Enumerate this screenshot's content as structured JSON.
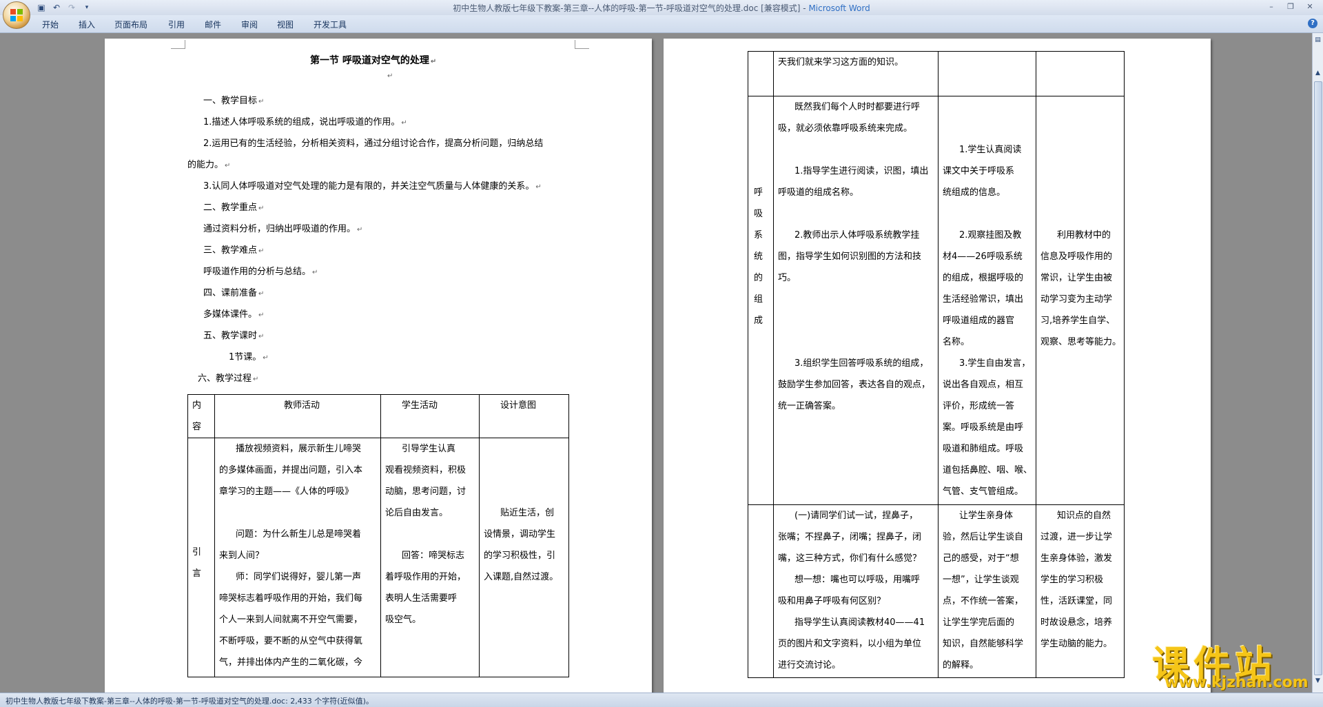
{
  "window": {
    "title_prefix": "初中生物人教版七年级下教案-第三章--人体的呼吸-第一节-呼吸道对空气的处理.doc [兼容模式] - ",
    "title_app": "Microsoft Word"
  },
  "ribbon": {
    "tabs": [
      "开始",
      "插入",
      "页面布局",
      "引用",
      "邮件",
      "审阅",
      "视图",
      "开发工具"
    ]
  },
  "icons": {
    "office": "office-button-icon",
    "save": "save-icon",
    "undo": "undo-icon",
    "redo": "redo-icon",
    "help": "help-icon"
  },
  "page1": {
    "title": "第一节   呼吸道对空气的处理",
    "lines": [
      "一、教学目标",
      "1.描述人体呼吸系统的组成，说出呼吸道的作用。",
      "2.运用已有的生活经验，分析相关资料，通过分组讨论合作，提高分析问题，归纳总结",
      "的能力。",
      "3.认同人体呼吸道对空气处理的能力是有限的，并关注空气质量与人体健康的关系。",
      "二、教学重点",
      "通过资料分析，归纳出呼吸道的作用。",
      "三、教学难点",
      "呼吸道作用的分析与总结。",
      "四、课前准备",
      "多媒体课件。",
      "五、教学课时",
      "1节课。",
      "六、教学过程"
    ],
    "table": {
      "headers": [
        "内\n容",
        "教师活动",
        "学生活动",
        "设计意图"
      ],
      "row_label": "引\n言",
      "teacher": [
        "播放视频资料，展示新生儿啼哭",
        "的多媒体画面，并提出问题，引入本",
        "章学习的主题——《人体的呼吸》",
        "",
        "问题：为什么新生儿总是啼哭着",
        "来到人间？",
        "师：同学们说得好，婴儿第一声",
        "啼哭标志着呼吸作用的开始，我们每",
        "个人一来到人间就离不开空气需要，",
        "不断呼吸，要不断的从空气中获得氧",
        "气，并排出体内产生的二氧化碳，今"
      ],
      "student": [
        "引导学生认真",
        "观看视频资料，积极",
        "动脑，思考问题，讨",
        "论后自由发言。",
        "",
        "回答：啼哭标志",
        "着呼吸作用的开始，",
        "表明人生活需要呼",
        "吸空气。"
      ],
      "intent": [
        "",
        "",
        "",
        "贴近生活，创",
        "设情景，调动学生",
        "的学习积极性，引",
        "入课题,自然过渡。"
      ]
    }
  },
  "page2": {
    "row1": [
      "天我们就来学习这方面的知识。"
    ],
    "row2_label": "呼\n吸\n系\n统\n的\n组\n成",
    "row2_teacher": [
      "既然我们每个人时时都要进行呼",
      "吸，就必须依靠呼吸系统来完成。",
      "",
      "1.指导学生进行阅读，识图，填出",
      "呼吸道的组成名称。",
      "",
      "2.教师出示人体呼吸系统教学挂",
      "图，指导学生如何识别图的方法和技",
      "巧。",
      "",
      "",
      "",
      "3.组织学生回答呼吸系统的组成，",
      "鼓励学生参加回答，表达各自的观点，",
      "统一正确答案。"
    ],
    "row2_student": [
      "",
      "",
      "1.学生认真阅读",
      "课文中关于呼吸系",
      "统组成的信息。",
      "",
      "2.观察挂图及教",
      "材4——26呼吸系统",
      "的组成，根据呼吸的",
      "生活经验常识，填出",
      "呼吸道组成的器官",
      "名称。",
      "3.学生自由发言，",
      "说出各自观点，相互",
      "评价，形成统一答",
      "案。呼吸系统是由呼",
      "吸道和肺组成。呼吸",
      "道包括鼻腔、咽、喉、",
      "气管、支气管组成。"
    ],
    "row2_intent": [
      "",
      "",
      "",
      "",
      "",
      "",
      "利用教材中的",
      "信息及呼吸作用的",
      "常识，让学生由被",
      "动学习变为主动学",
      "习,培养学生自学、",
      "观察、思考等能力。"
    ],
    "row3_teacher": [
      "(一)请同学们试一试，捏鼻子，",
      "张嘴；不捏鼻子，闭嘴；捏鼻子，闭",
      "嘴，这三种方式，你们有什么感觉？",
      "想一想：嘴也可以呼吸，用嘴呼",
      "吸和用鼻子呼吸有何区别？",
      "指导学生认真阅读教材40——41",
      "页的图片和文字资料，以小组为单位",
      "进行交流讨论。"
    ],
    "row3_student": [
      "让学生亲身体",
      "验，然后让学生谈自",
      "己的感受，对于“想",
      "一想”，让学生谈观",
      "点，不作统一答案，",
      "让学生学完后面的",
      "知识，自然能够科学",
      "的解释。"
    ],
    "row3_intent": [
      "知识点的自然",
      "过渡，进一步让学",
      "生亲身体验，激发",
      "学生的学习积极",
      "性，活跃课堂，同",
      "时故设悬念，培养",
      "学生动脑的能力。"
    ]
  },
  "status": {
    "text": "初中生物人教版七年级下教案-第三章--人体的呼吸-第一节-呼吸道对空气的处理.doc: 2,433 个字符(近似值)。"
  },
  "watermark": {
    "name": "课件站",
    "url": "www.kjzhan.com"
  }
}
